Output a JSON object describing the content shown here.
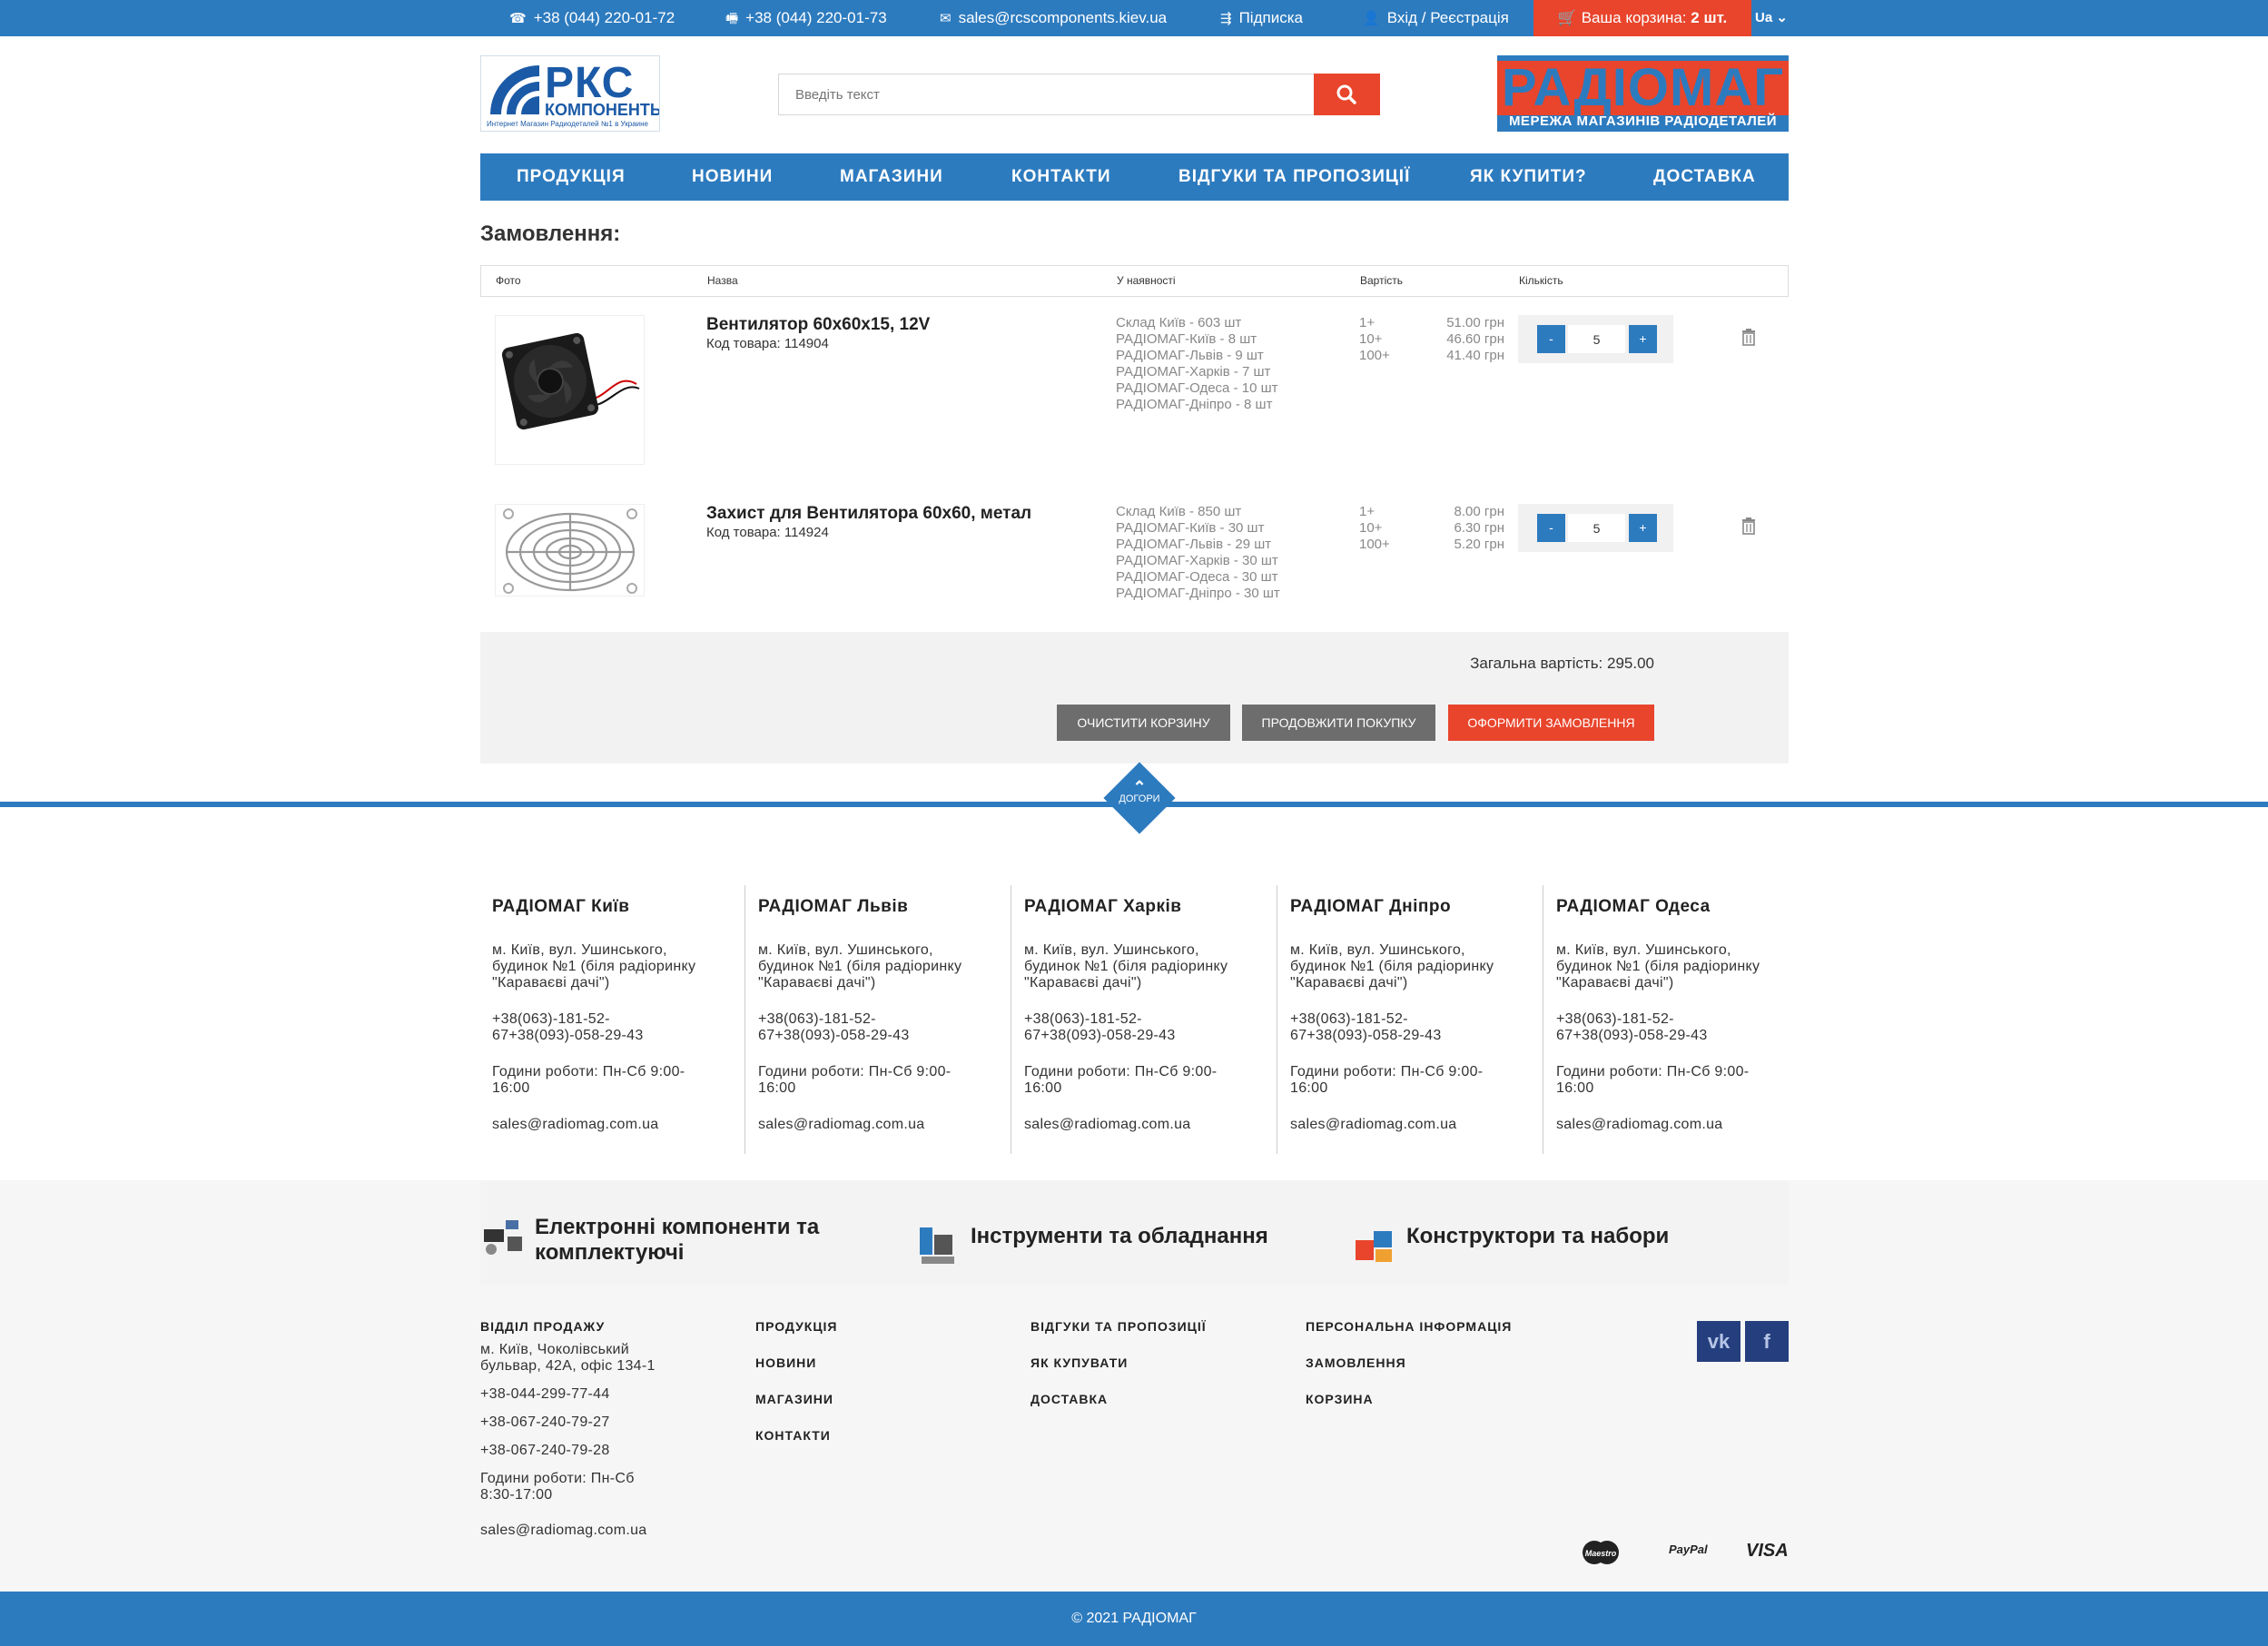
{
  "topbar": {
    "phone1": "+38 (044) 220-01-72",
    "phone2": "+38 (044) 220-01-73",
    "email": "sales@rcscomponents.kiev.ua",
    "subscribe": "Підписка",
    "login": "Вхід / Реєстрація",
    "cart_label": "Ваша корзина:",
    "cart_count": "2 шт.",
    "lang": "Ua"
  },
  "header": {
    "logo_left_big": "РКС",
    "logo_left_mid": "КОМПОНЕНТЫ",
    "logo_left_small": "Интернет Магазин Радиодеталей №1 в Украине",
    "search_placeholder": "Введіть текст",
    "logo_right_title": "РАДІОМАГ",
    "logo_right_sub": "МЕРЕЖА МАГАЗИНІВ РАДІОДЕТАЛЕЙ"
  },
  "nav": [
    "ПРОДУКЦІЯ",
    "НОВИНИ",
    "МАГАЗИНИ",
    "КОНТАКТИ",
    "ВІДГУКИ ТА ПРОПОЗИЦІЇ",
    "ЯК КУПИТИ?",
    "ДОСТАВКА"
  ],
  "order": {
    "title": "Замовлення:",
    "columns": [
      "Фото",
      "Назва",
      "У наявності",
      "Вартість",
      "Кількість"
    ],
    "items": [
      {
        "name": "Вентилятор 60х60х15, 12V",
        "code": "Код товара: 114904",
        "stock": [
          "Склад Київ - 603 шт",
          "РАДІОМАГ-Київ - 8 шт",
          "РАДІОМАГ-Львів - 9 шт",
          "РАДІОМАГ-Харків - 7 шт",
          "РАДІОМАГ-Одеса - 10 шт",
          "РАДІОМАГ-Дніпро - 8 шт"
        ],
        "prices": [
          [
            "1+",
            "51.00 грн"
          ],
          [
            "10+",
            "46.60 грн"
          ],
          [
            "100+",
            "41.40 грн"
          ]
        ],
        "qty": "5"
      },
      {
        "name": "Захист для Вентилятора 60х60, метал",
        "code": "Код товара: 114924",
        "stock": [
          "Склад Київ - 850 шт",
          "РАДІОМАГ-Київ - 30 шт",
          "РАДІОМАГ-Львів - 29 шт",
          "РАДІОМАГ-Харків - 30 шт",
          "РАДІОМАГ-Одеса - 30 шт",
          "РАДІОМАГ-Дніпро - 30 шт"
        ],
        "prices": [
          [
            "1+",
            "8.00 грн"
          ],
          [
            "10+",
            "6.30 грн"
          ],
          [
            "100+",
            "5.20 грн"
          ]
        ],
        "qty": "5"
      }
    ],
    "qty_minus": "-",
    "qty_plus": "+",
    "total": "Загальна вартість: 295.00",
    "btn_clear": "ОЧИСТИТИ КОРЗИНУ",
    "btn_continue": "ПРОДОВЖИТИ ПОКУПКУ",
    "btn_checkout": "ОФОРМИТИ ЗАМОВЛЕННЯ"
  },
  "scroll_up": "ДОГОРИ",
  "branches": [
    {
      "title": "РАДІОМАГ Київ",
      "address": "м. Київ, вул. Ушинського, будинок №1 (біля радіоринку \"Караваєві дачі\")",
      "phones": "+38(063)-181-52-67+38(093)-058-29-43",
      "hours": "Години роботи: Пн-Сб 9:00-16:00",
      "email": "sales@radiomag.com.ua"
    },
    {
      "title": "РАДІОМАГ Львів",
      "address": "м. Київ, вул. Ушинського, будинок №1 (біля радіоринку \"Караваєві дачі\")",
      "phones": "+38(063)-181-52-67+38(093)-058-29-43",
      "hours": "Години роботи: Пн-Сб 9:00-16:00",
      "email": "sales@radiomag.com.ua"
    },
    {
      "title": "РАДІОМАГ Харків",
      "address": "м. Київ, вул. Ушинського, будинок №1 (біля радіоринку \"Караваєві дачі\")",
      "phones": "+38(063)-181-52-67+38(093)-058-29-43",
      "hours": "Години роботи: Пн-Сб 9:00-16:00",
      "email": "sales@radiomag.com.ua"
    },
    {
      "title": "РАДІОМАГ Дніпро",
      "address": "м. Київ, вул. Ушинського, будинок №1 (біля радіоринку \"Караваєві дачі\")",
      "phones": "+38(063)-181-52-67+38(093)-058-29-43",
      "hours": "Години роботи: Пн-Сб 9:00-16:00",
      "email": "sales@radiomag.com.ua"
    },
    {
      "title": "РАДІОМАГ Одеса",
      "address": "м. Київ, вул. Ушинського, будинок №1 (біля радіоринку \"Караваєві дачі\")",
      "phones": "+38(063)-181-52-67+38(093)-058-29-43",
      "hours": "Години роботи: Пн-Сб 9:00-16:00",
      "email": "sales@radiomag.com.ua"
    }
  ],
  "categories": [
    {
      "line1": "Електронні компоненти та",
      "line2": "комплектуючі"
    },
    {
      "line1": "Інструменти та обладнання",
      "line2": ""
    },
    {
      "line1": "Конструктори та набори",
      "line2": ""
    }
  ],
  "footer": {
    "sales_title": "ВІДДІЛ ПРОДАЖУ",
    "sales_address": "м. Київ, Чоколівський бульвар, 42А, офіс 134-1",
    "sales_phones": [
      "+38-044-299-77-44",
      "+38-067-240-79-27",
      "+38-067-240-79-28"
    ],
    "sales_hours": "Години роботи: Пн-Сб 8:30-17:00",
    "sales_email": "sales@radiomag.com.ua",
    "col2": [
      "ПРОДУКЦІЯ",
      "НОВИНИ",
      "МАГАЗИНИ",
      "КОНТАКТИ"
    ],
    "col3": [
      "ВІДГУКИ ТА ПРОПОЗИЦІЇ",
      "ЯК КУПУВАТИ",
      "ДОСТАВКА"
    ],
    "col4": [
      "ПЕРСОНАЛЬНА ІНФОРМАЦІЯ",
      "ЗАМОВЛЕННЯ",
      "КОРЗИНА"
    ],
    "social": [
      "vk",
      "f"
    ],
    "payments": [
      "Maestro",
      "PayPal",
      "VISA"
    ],
    "copyright": "© 2021 РАДІОМАГ"
  },
  "colors": {
    "brand_blue": "#2d7bbf",
    "accent_red": "#e8452c",
    "grey_button": "#6d6d6d"
  }
}
